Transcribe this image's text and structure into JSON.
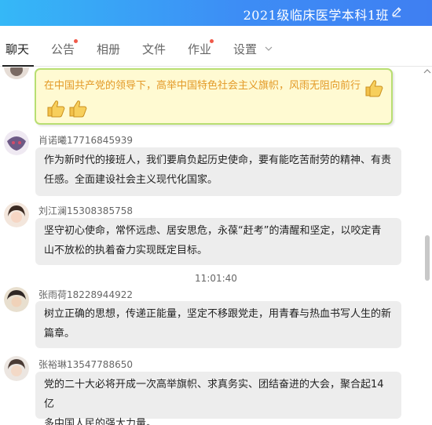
{
  "header": {
    "title": "2021级临床医学本科1班",
    "edit_icon": "pencil-icon",
    "gradient_start": "#35b8f7",
    "gradient_end": "#3f7ff2"
  },
  "tabs": [
    {
      "label": "聊天",
      "active": true,
      "has_dot": false
    },
    {
      "label": "公告",
      "active": false,
      "has_dot": true
    },
    {
      "label": "相册",
      "active": false,
      "has_dot": false
    },
    {
      "label": "文件",
      "active": false,
      "has_dot": false
    },
    {
      "label": "作业",
      "active": false,
      "has_dot": true
    },
    {
      "label": "设置",
      "active": false,
      "has_dot": false,
      "dropdown": true
    }
  ],
  "chat": {
    "special_message": {
      "text": "在中国共产党的领导下，高举中国特色社会主义旗帜，风雨无阻向前行",
      "emoji": "thumbs-up-icon",
      "emoji_count": 3,
      "text_color": "#e39a27",
      "background": "#fffad2",
      "border_color": "#b8de72"
    },
    "messages": [
      {
        "sender": "肖诺曦17716845939",
        "lines": [
          "作为新时代的接班人，我们要肩负起历史使命，要有能吃苦耐劳的精神、有责",
          "任感。全面建设社会主义现代化国家。"
        ]
      },
      {
        "sender": "刘江澜15308385758",
        "lines": [
          "坚守初心使命，常怀远虑、居安思危，永葆“赶考”的清醒和坚定，以咬定青",
          "山不放松的执着奋力实现既定目标。"
        ]
      }
    ],
    "timestamp": "11:01:40",
    "messages_after": [
      {
        "sender": "张雨荷18228944922",
        "lines": [
          "树立正确的思想，传递正能量，坚定不移跟党走，用青春与热血书写人生的新",
          "篇章。"
        ]
      },
      {
        "sender": "张裕琳13547788650",
        "lines": [
          "党的二十大必将开成一次高举旗帜、求真务实、团结奋进的大会，聚合起14亿",
          "多中国人民的强大力量。"
        ]
      }
    ]
  }
}
